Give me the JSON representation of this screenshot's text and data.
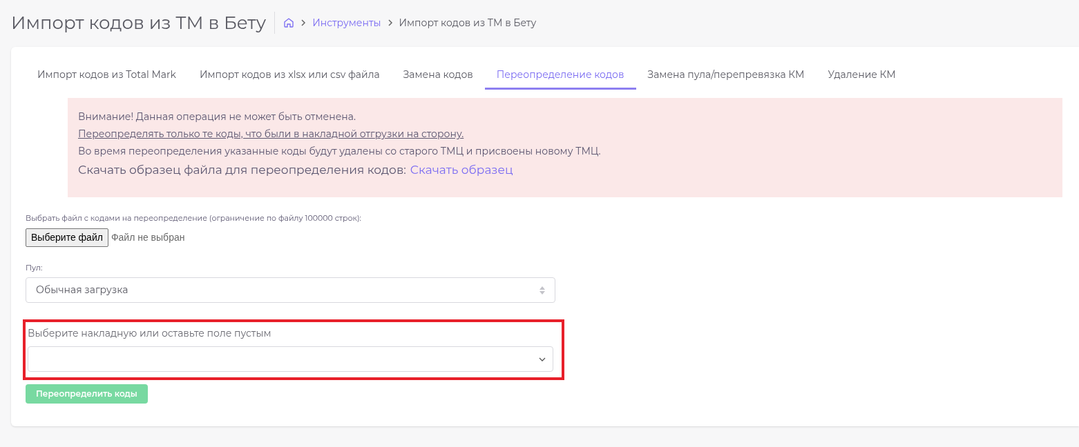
{
  "header": {
    "title": "Импорт кодов из ТМ в Бету",
    "breadcrumbs": [
      {
        "label": "Инструменты",
        "kind": "link"
      },
      {
        "label": "Импорт кодов из ТМ в Бету",
        "kind": "current"
      }
    ]
  },
  "tabs": [
    {
      "label": "Импорт кодов из Total Mark",
      "selected": false
    },
    {
      "label": "Импорт кодов из xlsx или csv файла",
      "selected": false
    },
    {
      "label": "Замена кодов",
      "selected": false
    },
    {
      "label": "Переопределение кодов",
      "selected": true
    },
    {
      "label": "Замена пула/перепревязка КМ",
      "selected": false
    },
    {
      "label": "Удаление КМ",
      "selected": false
    }
  ],
  "alert": {
    "lines": [
      "Внимание! Данная операция не может быть отменена.",
      "Переопределять только те коды, что были в накладной отгрузки на сторону.",
      "Во время переопределения указанные коды будут удалены со старого ТМЦ и присвоены новому ТМЦ."
    ],
    "sample_text": "Скачать образец файла для переопределения кодов:",
    "sample_link": "Скачать образец"
  },
  "file_field": {
    "label": "Выбрать файл с кодами на переопределение (ограничение по файлу 100000 строк):",
    "button": "Выберите файл",
    "status": "Файл не выбран"
  },
  "pool_field": {
    "label": "Пул:",
    "value": "Обычная загрузка"
  },
  "invoice_field": {
    "label": "Выберите накладную или оставьте поле пустым",
    "highlighted": true
  },
  "submit": {
    "label": "Переопределить коды",
    "disabled": true
  }
}
